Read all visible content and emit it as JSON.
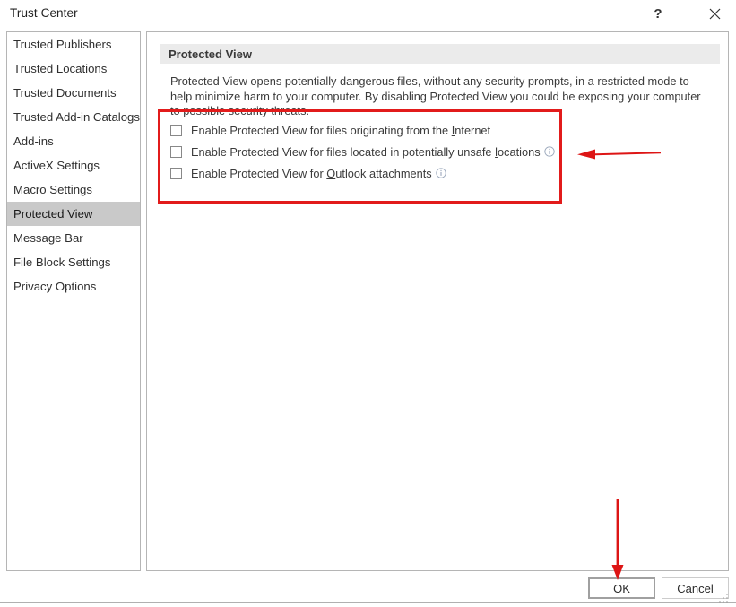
{
  "window": {
    "title": "Trust Center",
    "help_label": "?",
    "close_label": "close-icon"
  },
  "sidebar": {
    "items": [
      {
        "label": "Trusted Publishers",
        "selected": false
      },
      {
        "label": "Trusted Locations",
        "selected": false
      },
      {
        "label": "Trusted Documents",
        "selected": false
      },
      {
        "label": "Trusted Add-in Catalogs",
        "selected": false
      },
      {
        "label": "Add-ins",
        "selected": false
      },
      {
        "label": "ActiveX Settings",
        "selected": false
      },
      {
        "label": "Macro Settings",
        "selected": false
      },
      {
        "label": "Protected View",
        "selected": true
      },
      {
        "label": "Message Bar",
        "selected": false
      },
      {
        "label": "File Block Settings",
        "selected": false
      },
      {
        "label": "Privacy Options",
        "selected": false
      }
    ]
  },
  "content": {
    "header": "Protected View",
    "description": "Protected View opens potentially dangerous files, without any security prompts, in a restricted mode to help minimize harm to your computer. By disabling Protected View you could be exposing your computer to possible security threats.",
    "options": [
      {
        "label_before": "Enable Protected View for files originating from the ",
        "accelerator": "I",
        "label_after": "nternet",
        "checked": false,
        "has_info": false
      },
      {
        "label_before": "Enable Protected View for files located in potentially unsafe ",
        "accelerator": "l",
        "label_after": "ocations",
        "checked": false,
        "has_info": true
      },
      {
        "label_before": "Enable Protected View for ",
        "accelerator": "O",
        "label_after": "utlook attachments",
        "checked": false,
        "has_info": true
      }
    ]
  },
  "footer": {
    "ok_label": "OK",
    "cancel_label": "Cancel"
  },
  "annotations": {
    "color": "#e21b1b",
    "box_target": "protected-view-options-group",
    "arrow_horizontal_target": "protected-view-options-group",
    "arrow_vertical_target": "ok-button"
  }
}
